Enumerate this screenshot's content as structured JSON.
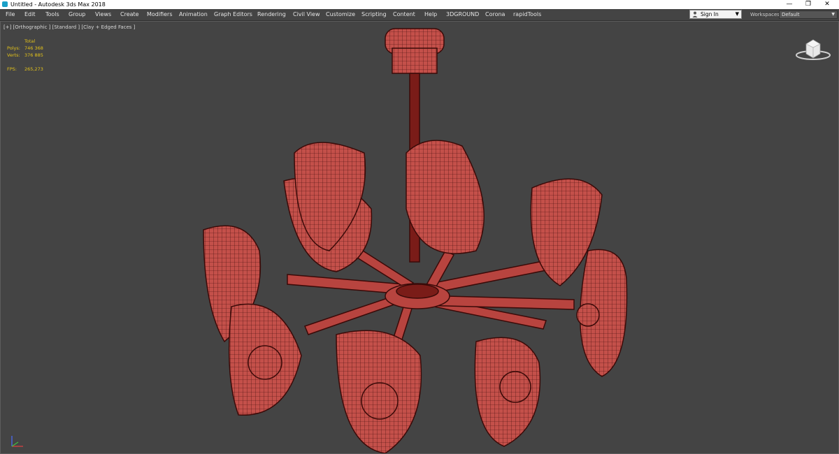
{
  "window": {
    "title": "Untitled - Autodesk 3ds Max 2018",
    "controls": {
      "minimize": "—",
      "restore": "❐",
      "close": "✕"
    }
  },
  "menu": [
    "File",
    "Edit",
    "Tools",
    "Group",
    "Views",
    "Create",
    "Modifiers",
    "Animation",
    "Graph Editors",
    "Rendering",
    "Civil View",
    "Customize",
    "Scripting",
    "Content",
    "Help",
    "3DGROUND",
    "Corona",
    "rapidTools"
  ],
  "account": {
    "sign_in": "Sign In",
    "caret": "▼"
  },
  "workspaces": {
    "label": "Workspaces:",
    "value": "Default",
    "caret": "▼"
  },
  "viewport": {
    "label": "[+] [Orthographic ] [Standard ] [Clay + Edged Faces ]",
    "stats": {
      "header": "Total",
      "polys_label": "Polys:",
      "polys_value": "746 368",
      "verts_label": "Verts:",
      "verts_value": "376 885",
      "fps_label": "FPS:",
      "fps_value": "265,273"
    }
  },
  "colors": {
    "viewport_bg": "#444444",
    "mesh_fill": "#c4504a",
    "mesh_wire": "#3a0a08",
    "stats_text": "#e3c21a"
  },
  "icons": {
    "app": "3ds-max-app-icon",
    "user": "user-icon",
    "viewcube": "viewcube-icon",
    "axis": "axis-tripod-icon"
  }
}
